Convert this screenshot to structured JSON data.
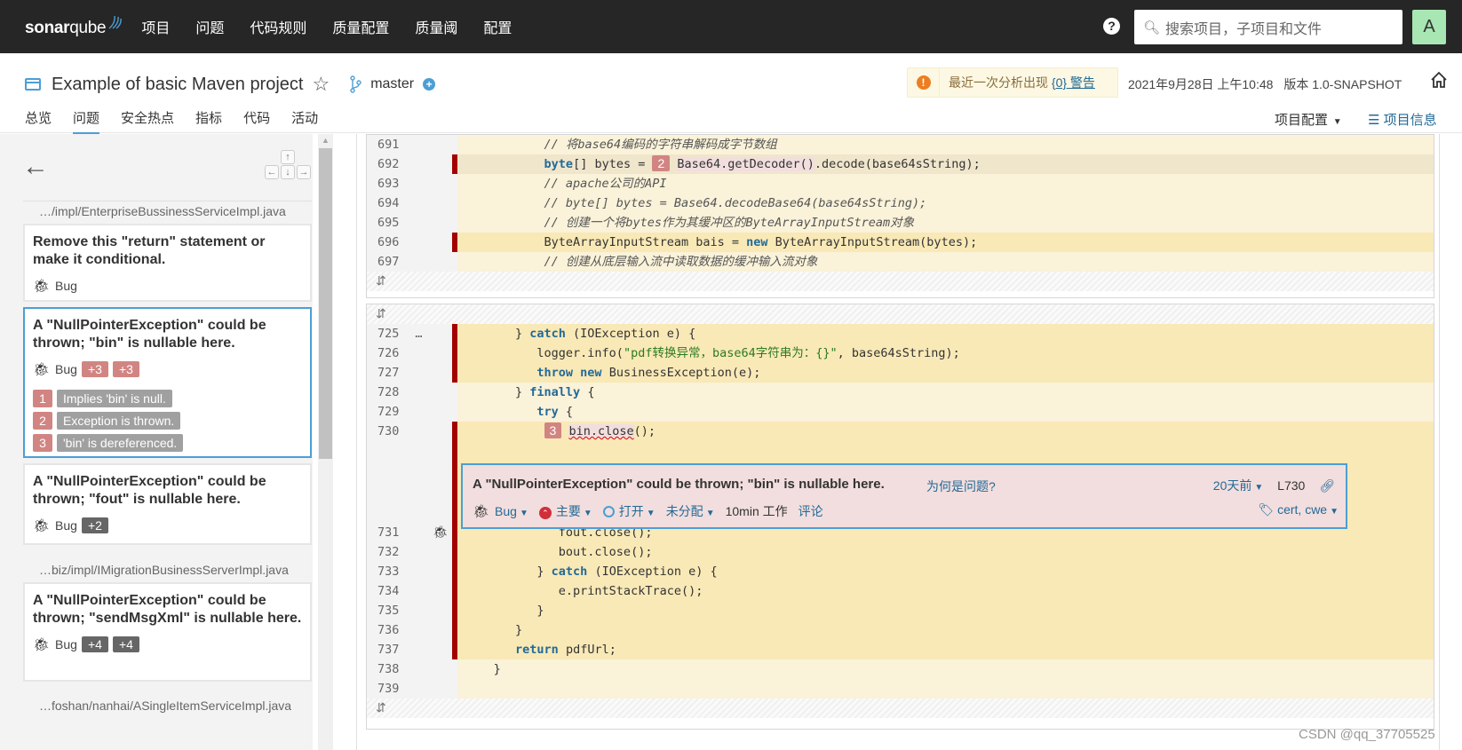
{
  "topbar": {
    "logo_bold": "sonar",
    "logo_light": "qube",
    "nav": [
      "项目",
      "问题",
      "代码规则",
      "质量配置",
      "质量阈",
      "配置"
    ],
    "help_icon": "?",
    "search_placeholder": "搜索项目，子项目和文件",
    "avatar": "A"
  },
  "project": {
    "name": "Example of basic Maven project",
    "branch": "master",
    "warning_prefix": "最近一次分析出现",
    "warning_link": "{0} 警告",
    "date": "2021年9月28日 上午10:48",
    "version": "版本 1.0-SNAPSHOT",
    "tabs": [
      "总览",
      "问题",
      "安全热点",
      "指标",
      "代码",
      "活动"
    ],
    "active_tab": "问题",
    "project_settings": "项目配置",
    "project_info": "项目信息"
  },
  "sidebar": {
    "keys": {
      "up": "↑",
      "left": "←",
      "down": "↓",
      "right": "→"
    },
    "files": [
      "…/impl/EnterpriseBussinessServiceImpl.java",
      "…biz/impl/IMigrationBusinessServerImpl.java",
      "…foshan/nanhai/ASingleItemServiceImpl.java"
    ],
    "issues": [
      {
        "message": "Remove this \"return\" statement or make it conditional.",
        "type": "Bug",
        "badges": []
      },
      {
        "message": "A \"NullPointerException\" could be thrown; \"bin\" is nullable here.",
        "type": "Bug",
        "badges": [
          "+3",
          "+3"
        ],
        "flows": [
          {
            "n": "1",
            "text": "Implies 'bin' is null."
          },
          {
            "n": "2",
            "text": "Exception is thrown."
          },
          {
            "n": "3",
            "text": "'bin' is dereferenced."
          }
        ]
      },
      {
        "message": "A \"NullPointerException\" could be thrown; \"fout\" is nullable here.",
        "type": "Bug",
        "badges": [
          "+2"
        ]
      },
      {
        "message": "A \"NullPointerException\" could be thrown; \"sendMsgXml\" is nullable here.",
        "type": "Bug",
        "badges": [
          "+4",
          "+4"
        ]
      }
    ]
  },
  "source": {
    "block1": [
      {
        "ln": "691",
        "code": "            // 将base64编码的字符串解码成字节数组"
      },
      {
        "ln": "692",
        "pre": "            ",
        "kw": "byte",
        "post1": "[] bytes = ",
        "loc": "2",
        "mark": "Base64.getDecoder()",
        "rest": ".decode(base64sString);"
      },
      {
        "ln": "693",
        "code": "            // apache公司的API"
      },
      {
        "ln": "694",
        "code": "            // byte[] bytes = Base64.decodeBase64(base64sString);"
      },
      {
        "ln": "695",
        "code": "            // 创建一个将bytes作为其缓冲区的ByteArrayInputStream对象"
      },
      {
        "ln": "696",
        "pre": "            ByteArrayInputStream bais = ",
        "kw": "new",
        "post1": " ByteArrayInputStream(bytes);"
      },
      {
        "ln": "697",
        "code": "            // 创建从底层输入流中读取数据的缓冲输入流对象"
      }
    ],
    "block2": [
      {
        "ln": "725",
        "dots": "…",
        "pre": "        } ",
        "kw": "catch",
        "post1": " (IOException e) {"
      },
      {
        "ln": "726",
        "pre": "           logger.info(",
        "str": "\"pdf转换异常，base64字符串为：{}\"",
        "post1": ", base64sString);"
      },
      {
        "ln": "727",
        "pre": "           ",
        "kw": "throw new",
        "post1": " BusinessException(e);"
      },
      {
        "ln": "728",
        "pre": "        } ",
        "kw": "finally",
        "post1": " {"
      },
      {
        "ln": "729",
        "pre": "           ",
        "kw": "try",
        "post1": " {"
      },
      {
        "ln": "730",
        "pre": "            ",
        "loc": "3",
        "squig": "bin.close",
        "rest": "();"
      },
      {
        "ln": "731",
        "code": "              fout.close();"
      },
      {
        "ln": "732",
        "code": "              bout.close();"
      },
      {
        "ln": "733",
        "pre": "           } ",
        "kw": "catch",
        "post1": " (IOException e) {"
      },
      {
        "ln": "734",
        "code": "              e.printStackTrace();"
      },
      {
        "ln": "735",
        "code": "           }"
      },
      {
        "ln": "736",
        "code": "        }"
      },
      {
        "ln": "737",
        "pre": "        ",
        "kw": "return",
        "post1": " pdfUrl;"
      },
      {
        "ln": "738",
        "code": "     }"
      },
      {
        "ln": "739",
        "code": ""
      }
    ]
  },
  "issue_box": {
    "title": "A \"NullPointerException\" could be thrown; \"bin\" is nullable here.",
    "why": "为何是问题?",
    "type": "Bug",
    "severity": "主要",
    "status": "打开",
    "assignee": "未分配",
    "effort": "10min 工作",
    "comment": "评论",
    "age": "20天前",
    "line_ref": "L730",
    "tags": "cert, cwe"
  },
  "watermark": "CSDN @qq_37705525",
  "colors": {
    "accent": "#4b9fd5",
    "topbar": "#262626",
    "scm_red": "#a30000",
    "flow_badge": "#d18582"
  }
}
